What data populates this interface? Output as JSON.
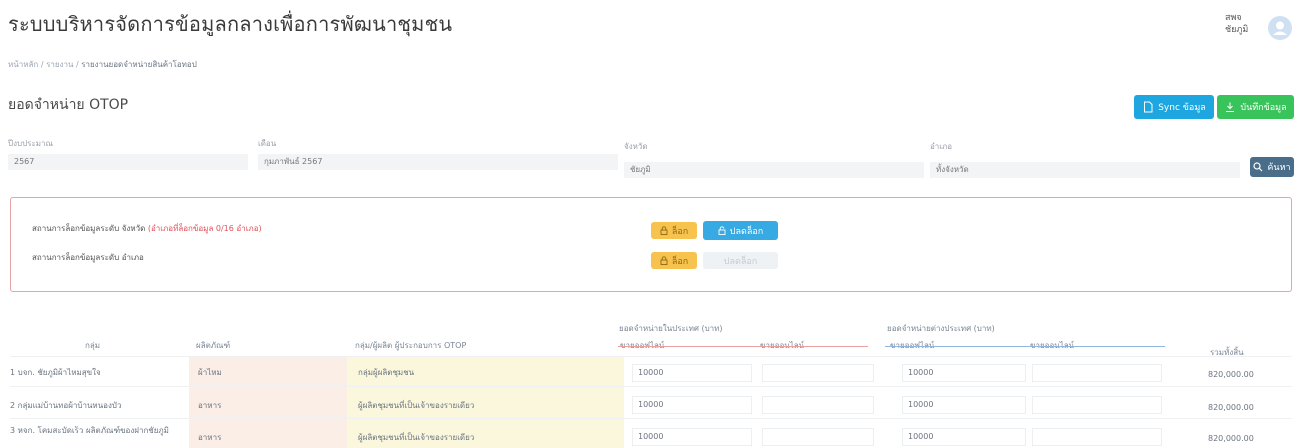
{
  "app": {
    "title": "ระบบบริหารจัดการข้อมูลกลางเพื่อการพัฒนาชุมชน"
  },
  "user": {
    "line1": "สพจ",
    "line2": "ชัยภูมิ"
  },
  "breadcrumb": {
    "item1": "หน้าหลัก",
    "sep": "/",
    "item2": "รายงาน",
    "item3": "รายงานยอดจำหน่ายสินค้าโอทอป"
  },
  "page": {
    "title": "ยอดจำหน่าย OTOP"
  },
  "actions": {
    "sync_label": "Sync ข้อมูล",
    "save_label": "บันทึกข้อมูล"
  },
  "filters": {
    "year_label": "ปีงบประมาณ",
    "year_value": "2567",
    "month_label": "เดือน",
    "month_value": "กุมภาพันธ์ 2567",
    "province_label": "จังหวัด",
    "province_value": "ชัยภูมิ",
    "district_label": "อำเภอ",
    "district_value": "ทั้งจังหวัด",
    "search_label": "ค้นหา"
  },
  "status": {
    "province_label": "สถานการล็อกข้อมูลระดับ จังหวัด",
    "province_hint": "(อำเภอที่ล็อกข้อมูล 0/16 อำเภอ)",
    "district_label": "สถานการล็อกข้อมูลระดับ อำเภอ",
    "lock_label": "ล็อก",
    "unlock_label": "ปลดล็อก"
  },
  "table": {
    "group_header": "กลุ่ม",
    "product_header": "ผลิตภัณฑ์",
    "type_header": "กลุ่ม/ผู้ผลิต ผู้ประกอบการ OTOP",
    "domestic_header": "ยอดจำหน่ายในประเทศ (บาท)",
    "abroad_header": "ยอดจำหน่ายต่างประเทศ (บาท)",
    "sub_offline": "ขายออฟไลน์",
    "sub_online": "ขายออนไลน์",
    "total_header": "รวมทั้งสิ้น",
    "rows": [
      {
        "group": "1 บจก. ชัยภูมิผ้าไหมสุขใจ",
        "product": "ผ้าไหม",
        "type": "กลุ่มผู้ผลิตชุมชน",
        "dom_off": "10000",
        "abr_off": "10000",
        "total": "820,000.00"
      },
      {
        "group": "2 กลุ่มแม่บ้านทอผ้าบ้านหนองบัว",
        "product": "อาหาร",
        "type": "ผู้ผลิตชุมชนที่เป็นเจ้าของรายเดียว",
        "dom_off": "10000",
        "abr_off": "10000",
        "total": "820,000.00"
      },
      {
        "group": "3 หจก. โคมสะบัดเร็ว ผลิตภัณฑ์ของฝากชัยภูมิ",
        "product": "อาหาร",
        "type": "ผู้ผลิตชุมชนที่เป็นเจ้าของรายเดียว",
        "dom_off": "10000",
        "abr_off": "10000",
        "total": "820,000.00"
      }
    ]
  },
  "colors": {
    "sync": "#1ea6e0",
    "save": "#39c35b",
    "lock": "#f7c24e",
    "unlock": "#37a9e3",
    "search": "#4a6e8a"
  }
}
